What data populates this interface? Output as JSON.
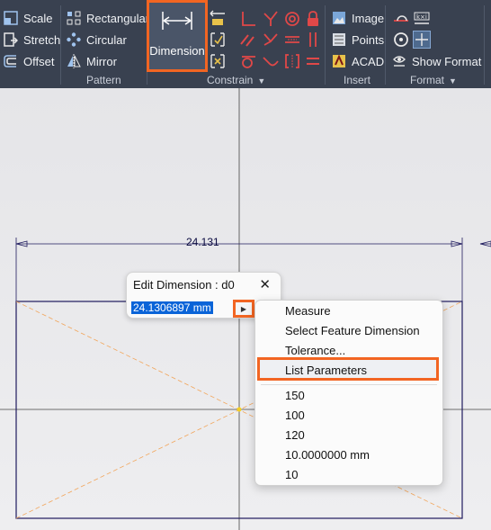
{
  "ribbon": {
    "modify": {
      "scale": "Scale",
      "stretch": "Stretch",
      "offset": "Offset"
    },
    "pattern": {
      "rectangular": "Rectangular",
      "circular": "Circular",
      "mirror": "Mirror",
      "label": "Pattern"
    },
    "constrain": {
      "dimension": "Dimension",
      "label": "Constrain"
    },
    "insert": {
      "image": "Image",
      "points": "Points",
      "acad": "ACAD",
      "label": "Insert"
    },
    "format": {
      "show_format": "Show Format",
      "label": "Format"
    }
  },
  "drawing": {
    "dimension_value": "24.131"
  },
  "edit_dimension": {
    "title": "Edit Dimension : d0",
    "value": "24.1306897 mm",
    "close": "✕"
  },
  "context_menu": {
    "items": [
      "Measure",
      "Select Feature Dimension",
      "Tolerance...",
      "List Parameters"
    ],
    "recent": [
      "150",
      "100",
      "120",
      "10.0000000 mm",
      "10"
    ]
  },
  "colors": {
    "ribbon_bg": "#394150",
    "highlight": "#f26522",
    "selection": "#0a64d8"
  }
}
